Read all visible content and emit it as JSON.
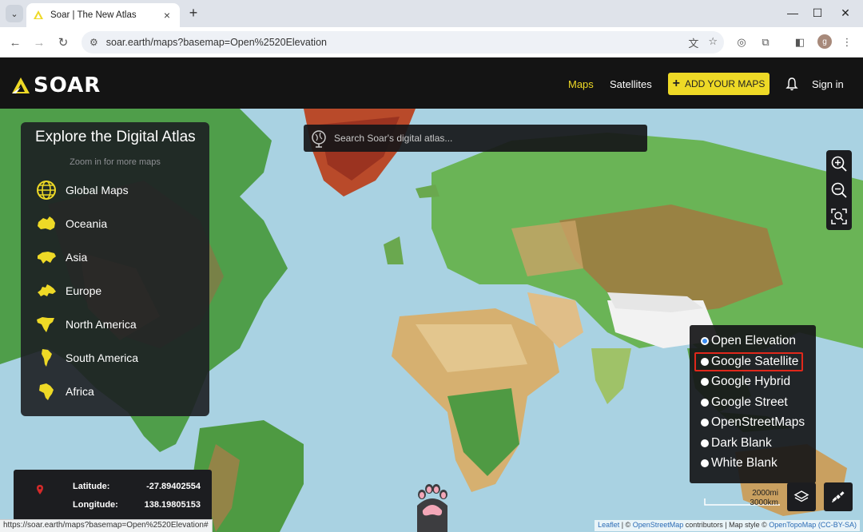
{
  "browser": {
    "tab_title": "Soar | The New Atlas",
    "url": "soar.earth/maps?basemap=Open%2520Elevation",
    "profile_initial": "g",
    "status_url": "https://soar.earth/maps?basemap=Open%2520Elevation#"
  },
  "site": {
    "logo_text": "SOAR",
    "nav_maps": "Maps",
    "nav_satellites": "Satellites",
    "add_maps_label": "ADD YOUR MAPS",
    "signin": "Sign in",
    "accent_color": "#eed926"
  },
  "explore": {
    "title": "Explore the Digital Atlas",
    "subtitle": "Zoom in for more maps",
    "regions": [
      {
        "label": "Global Maps",
        "icon": "globe-icon"
      },
      {
        "label": "Oceania",
        "icon": "australia-icon"
      },
      {
        "label": "Asia",
        "icon": "asia-icon"
      },
      {
        "label": "Europe",
        "icon": "europe-icon"
      },
      {
        "label": "North America",
        "icon": "north-america-icon"
      },
      {
        "label": "South America",
        "icon": "south-america-icon"
      },
      {
        "label": "Africa",
        "icon": "africa-icon"
      }
    ]
  },
  "search": {
    "placeholder": "Search Soar's digital atlas..."
  },
  "basemap": {
    "selected": "Open Elevation",
    "highlighted": "Google Satellite",
    "options": [
      "Open Elevation",
      "Google Satellite",
      "Google Hybrid",
      "Google Street",
      "OpenStreetMaps",
      "Dark Blank",
      "White Blank"
    ]
  },
  "coords": {
    "latitude_label": "Latitude:",
    "latitude": "-27.89402554",
    "longitude_label": "Longitude:",
    "longitude": "138.19805153"
  },
  "scale": {
    "miles": "2000mi",
    "km": "3000km"
  },
  "attribution": {
    "leaflet": "Leaflet",
    "sep1": " | © ",
    "osm": "OpenStreetMap",
    "mid": " contributors | Map style © ",
    "otm": "OpenTopoMap",
    "license": "(CC-BY-SA)"
  }
}
